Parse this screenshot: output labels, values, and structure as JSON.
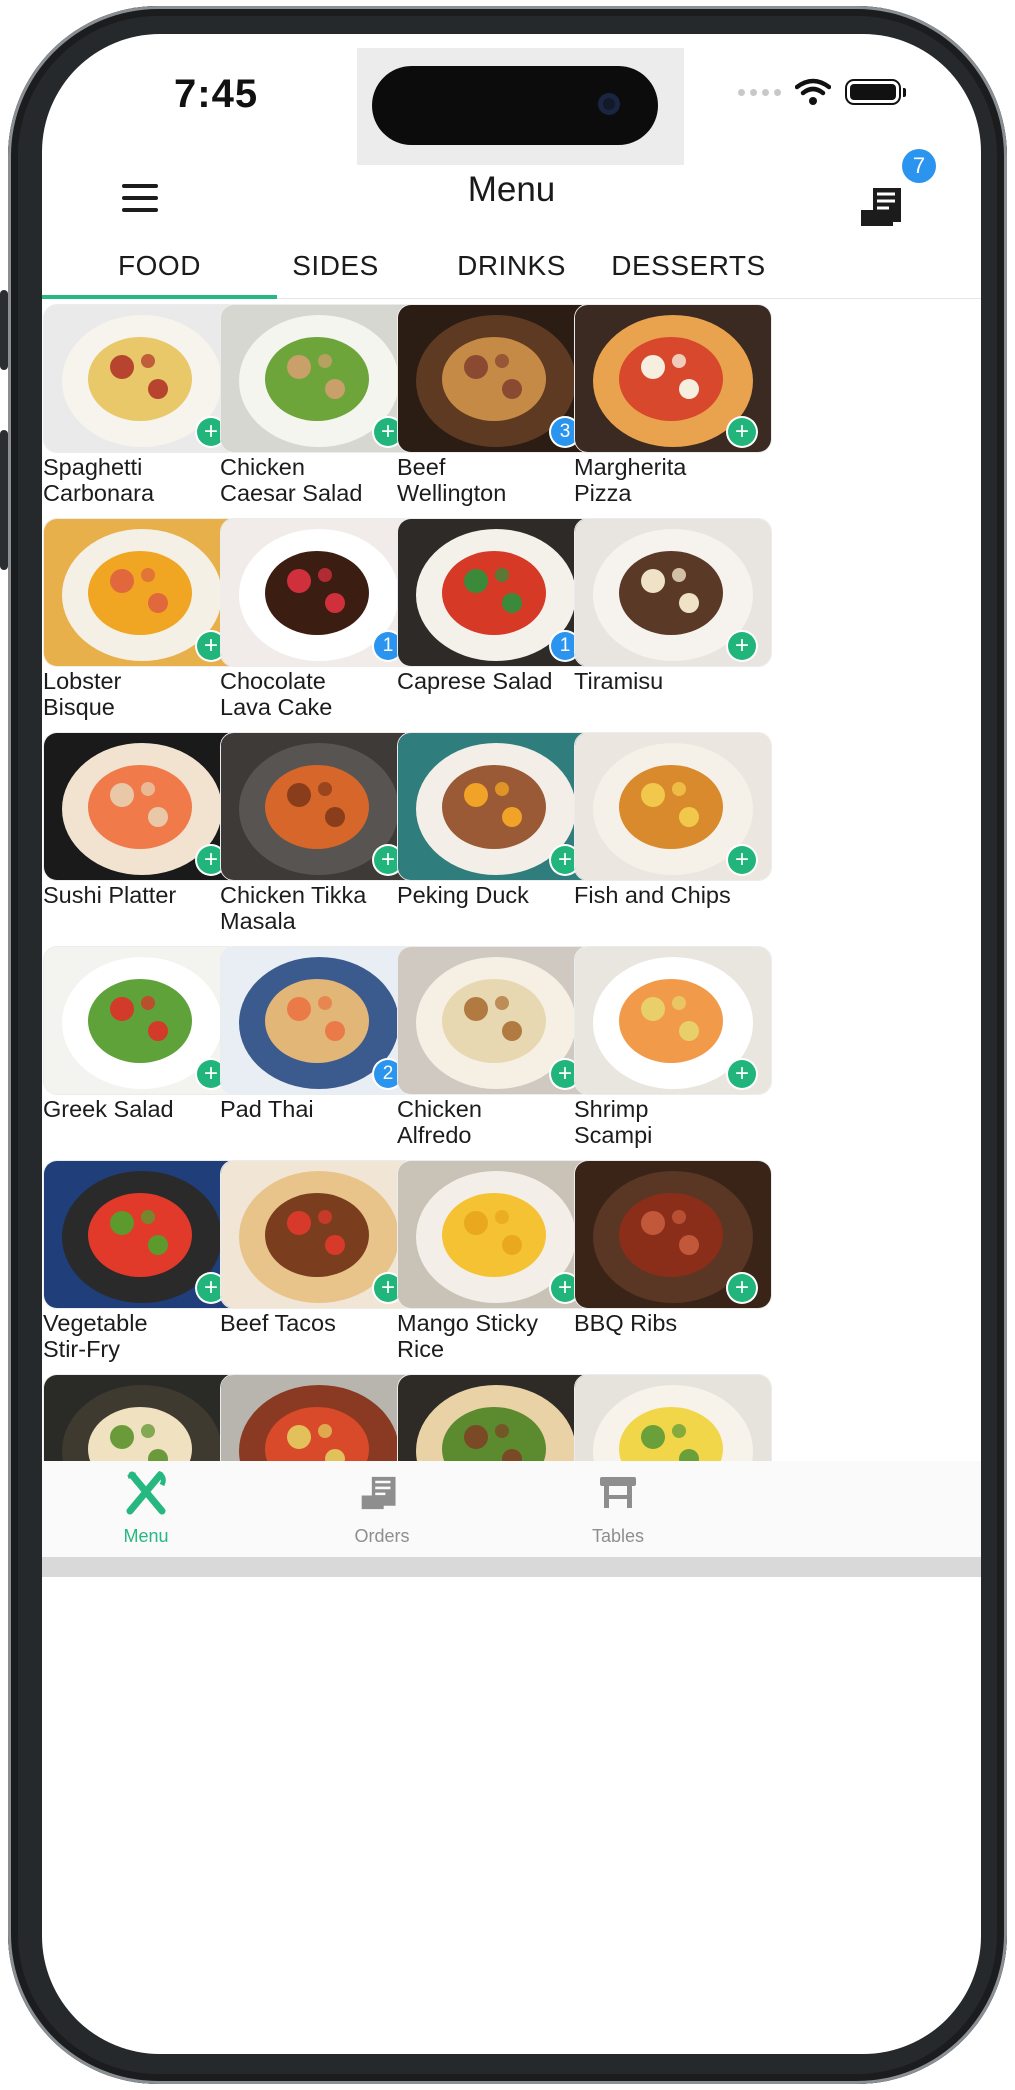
{
  "status_bar": {
    "time": "7:45"
  },
  "header": {
    "title": "Menu",
    "orders_count": "7"
  },
  "tabs": [
    {
      "label": "FOOD",
      "active": true
    },
    {
      "label": "SIDES",
      "active": false
    },
    {
      "label": "DRINKS",
      "active": false
    },
    {
      "label": "DESSERTS",
      "active": false
    }
  ],
  "menu_items": [
    {
      "name_line1": "Spaghetti",
      "name_line2": "Carbonara",
      "badge": "",
      "icon": "pasta"
    },
    {
      "name_line1": "Chicken",
      "name_line2": "Caesar Salad",
      "badge": "",
      "icon": "salad"
    },
    {
      "name_line1": "Beef",
      "name_line2": "Wellington",
      "badge": "3",
      "icon": "roast"
    },
    {
      "name_line1": "Margherita",
      "name_line2": "Pizza",
      "badge": "",
      "icon": "pizza"
    },
    {
      "name_line1": "Lobster",
      "name_line2": "Bisque",
      "badge": "",
      "icon": "soup"
    },
    {
      "name_line1": "Chocolate",
      "name_line2": "Lava Cake",
      "badge": "1",
      "icon": "cake"
    },
    {
      "name_line1": "Caprese Salad",
      "name_line2": "",
      "badge": "1",
      "icon": "caprese"
    },
    {
      "name_line1": "Tiramisu",
      "name_line2": "",
      "badge": "",
      "icon": "tiramisu"
    },
    {
      "name_line1": "Sushi Platter",
      "name_line2": "",
      "badge": "",
      "icon": "sushi"
    },
    {
      "name_line1": "Chicken Tikka",
      "name_line2": "Masala",
      "badge": "",
      "icon": "curry"
    },
    {
      "name_line1": "Peking Duck",
      "name_line2": "",
      "badge": "",
      "icon": "duck"
    },
    {
      "name_line1": "Fish and Chips",
      "name_line2": "",
      "badge": "",
      "icon": "fish"
    },
    {
      "name_line1": "Greek Salad",
      "name_line2": "",
      "badge": "",
      "icon": "greek"
    },
    {
      "name_line1": "Pad Thai",
      "name_line2": "",
      "badge": "2",
      "icon": "noodles"
    },
    {
      "name_line1": "Chicken",
      "name_line2": "Alfredo",
      "badge": "",
      "icon": "alfredo"
    },
    {
      "name_line1": "Shrimp",
      "name_line2": "Scampi",
      "badge": "",
      "icon": "shrimp"
    },
    {
      "name_line1": "Vegetable",
      "name_line2": "Stir-Fry",
      "badge": "",
      "icon": "stirfry"
    },
    {
      "name_line1": "Beef Tacos",
      "name_line2": "",
      "badge": "",
      "icon": "tacos"
    },
    {
      "name_line1": "Mango Sticky",
      "name_line2": "Rice",
      "badge": "",
      "icon": "mango"
    },
    {
      "name_line1": "BBQ Ribs",
      "name_line2": "",
      "badge": "",
      "icon": "ribs"
    },
    {
      "name_line1": "",
      "name_line2": "",
      "badge": "",
      "icon": "ramen"
    },
    {
      "name_line1": "",
      "name_line2": "",
      "badge": "",
      "icon": "ratatouille"
    },
    {
      "name_line1": "",
      "name_line2": "",
      "badge": "",
      "icon": "wrap"
    },
    {
      "name_line1": "",
      "name_line2": "",
      "badge": "",
      "icon": "benedict"
    }
  ],
  "add_symbol": "+",
  "bottom_nav": [
    {
      "label": "Menu",
      "active": true,
      "icon": "fork-knife-icon"
    },
    {
      "label": "Orders",
      "active": false,
      "icon": "receipt-icon"
    },
    {
      "label": "Tables",
      "active": false,
      "icon": "table-icon"
    }
  ],
  "colors": {
    "accent": "#27b882",
    "badge": "#2a94ee",
    "inactive": "#8e8e8e"
  }
}
